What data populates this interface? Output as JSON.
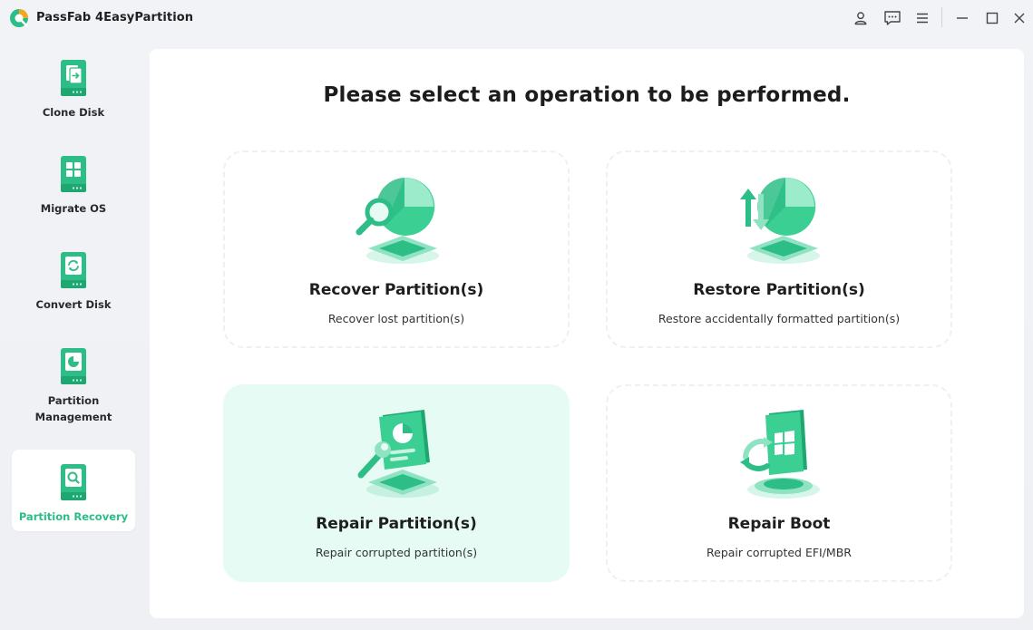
{
  "app": {
    "title": "PassFab 4EasyPartition",
    "brand_color": "#2dbd86"
  },
  "titlebar": {
    "icons": [
      "user-icon",
      "feedback-icon",
      "menu-icon",
      "minimize-icon",
      "maximize-icon",
      "close-icon"
    ]
  },
  "sidebar": {
    "items": [
      {
        "label": "Clone Disk",
        "icon": "clone-disk-icon"
      },
      {
        "label": "Migrate OS",
        "icon": "migrate-os-icon"
      },
      {
        "label": "Convert Disk",
        "icon": "convert-disk-icon"
      },
      {
        "label": "Partition\nManagement",
        "icon": "partition-management-icon"
      },
      {
        "label": "Partition Recovery",
        "icon": "partition-recovery-icon",
        "active": true
      }
    ]
  },
  "main": {
    "title": "Please select an operation to be performed.",
    "cards": [
      {
        "title": "Recover Partition(s)",
        "desc": "Recover lost partition(s)",
        "icon": "recover-partition-icon"
      },
      {
        "title": "Restore Partition(s)",
        "desc": "Restore accidentally formatted partition(s)",
        "icon": "restore-partition-icon"
      },
      {
        "title": "Repair Partition(s)",
        "desc": "Repair corrupted partition(s)",
        "icon": "repair-partition-icon",
        "selected": true
      },
      {
        "title": "Repair Boot",
        "desc": "Repair corrupted EFI/MBR",
        "icon": "repair-boot-icon"
      }
    ]
  }
}
